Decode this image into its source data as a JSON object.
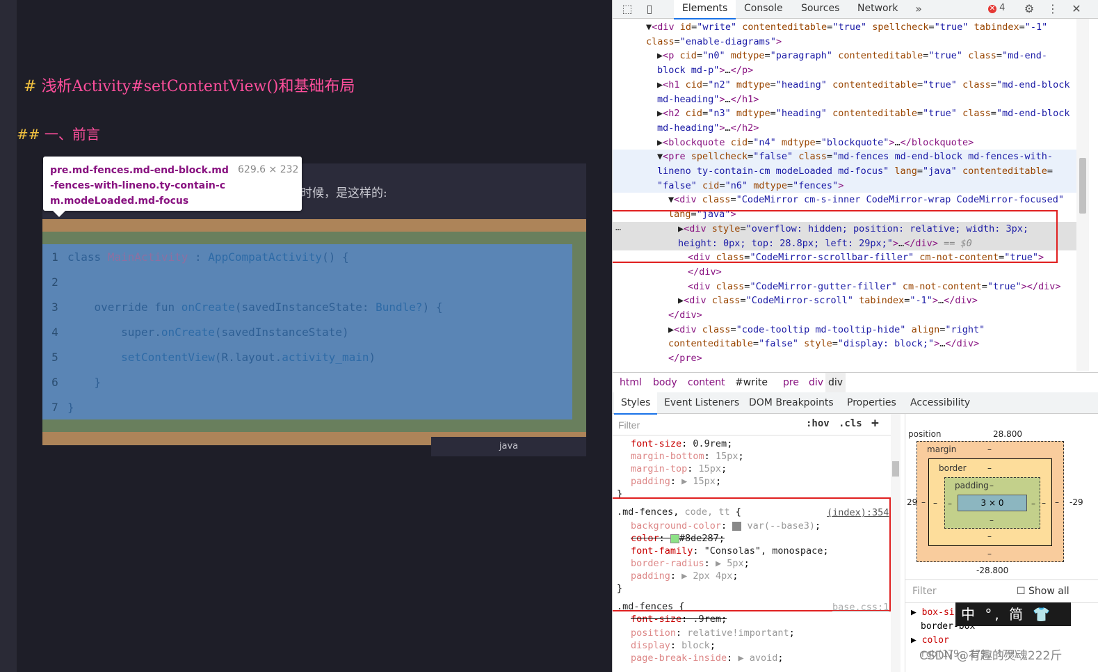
{
  "editor": {
    "h1_hash": "#",
    "h1_text": "浅析Activity#setContentView()和基础布局",
    "h2_hash": "##",
    "h2_text": "一、前言",
    "quote_text": "时候，是这样的:",
    "lang_label": "java",
    "code": [
      {
        "n": "1",
        "parts": [
          [
            "kw",
            "class "
          ],
          [
            "ty",
            "MainActivity"
          ],
          [
            "kw",
            " : "
          ],
          [
            "fn",
            "AppCompatActivity"
          ],
          [
            "kw",
            "() {"
          ]
        ]
      },
      {
        "n": "2",
        "parts": []
      },
      {
        "n": "3",
        "parts": [
          [
            "kw",
            "    override fun "
          ],
          [
            "fn",
            "onCreate"
          ],
          [
            "kw",
            "(savedInstanceState: "
          ],
          [
            "fn",
            "Bundle?"
          ],
          [
            "kw",
            ") {"
          ]
        ]
      },
      {
        "n": "4",
        "parts": [
          [
            "kw",
            "        super."
          ],
          [
            "fn",
            "onCreate"
          ],
          [
            "kw",
            "(savedInstanceState)"
          ]
        ]
      },
      {
        "n": "5",
        "parts": [
          [
            "kw",
            "        "
          ],
          [
            "fn",
            "setContentView"
          ],
          [
            "kw",
            "(R.layout."
          ],
          [
            "fn",
            "activity_main"
          ],
          [
            "kw",
            ")"
          ]
        ]
      },
      {
        "n": "6",
        "parts": [
          [
            "kw",
            "    }"
          ]
        ]
      },
      {
        "n": "7",
        "parts": [
          [
            "kw",
            "}"
          ]
        ]
      }
    ]
  },
  "tooltip": {
    "selector": "pre.md-fences.md-end-block.md-fences-with-lineno.ty-contain-cm.modeLoaded.md-focus",
    "dimensions": "629.6 × 232"
  },
  "toolbar": {
    "tabs": [
      "Elements",
      "Console",
      "Sources",
      "Network"
    ],
    "more": "»",
    "error_count": "4",
    "error_mark": "✕"
  },
  "dom_lines": [
    {
      "html": "▼<span class='t'>&lt;div</span> <span class='a'>id</span>=<span class='v'>\"write\"</span> <span class='a'>contenteditable</span>=<span class='v'>\"true\"</span> <span class='a'>spellcheck</span>=<span class='v'>\"true\"</span> <span class='a'>tabindex</span>=<span class='v'>\"-1\"</span>"
    },
    {
      "html": "<span class='a'>class</span>=<span class='v'>\"enable-diagrams\"</span><span class='t'>&gt;</span>"
    },
    {
      "html": "▶<span class='t'>&lt;p</span> <span class='a'>cid</span>=<span class='v'>\"n0\"</span> <span class='a'>mdtype</span>=<span class='v'>\"paragraph\"</span> <span class='a'>contenteditable</span>=<span class='v'>\"true\"</span> <span class='a'>class</span>=<span class='v'>\"md-end-</span>"
    },
    {
      "html": "<span class='v'>block md-p\"</span><span class='t'>&gt;</span>…<span class='t'>&lt;/p&gt;</span>"
    },
    {
      "html": "▶<span class='t'>&lt;h1</span> <span class='a'>cid</span>=<span class='v'>\"n2\"</span> <span class='a'>mdtype</span>=<span class='v'>\"heading\"</span> <span class='a'>contenteditable</span>=<span class='v'>\"true\"</span> <span class='a'>class</span>=<span class='v'>\"md-end-block</span>"
    },
    {
      "html": "<span class='v'>md-heading\"</span><span class='t'>&gt;</span>…<span class='t'>&lt;/h1&gt;</span>"
    },
    {
      "html": "▶<span class='t'>&lt;h2</span> <span class='a'>cid</span>=<span class='v'>\"n3\"</span> <span class='a'>mdtype</span>=<span class='v'>\"heading\"</span> <span class='a'>contenteditable</span>=<span class='v'>\"true\"</span> <span class='a'>class</span>=<span class='v'>\"md-end-block</span>"
    },
    {
      "html": "<span class='v'>md-heading\"</span><span class='t'>&gt;</span>…<span class='t'>&lt;/h2&gt;</span>"
    },
    {
      "html": "▶<span class='t'>&lt;blockquote</span> <span class='a'>cid</span>=<span class='v'>\"n4\"</span> <span class='a'>mdtype</span>=<span class='v'>\"blockquote\"</span><span class='t'>&gt;</span>…<span class='t'>&lt;/blockquote&gt;</span>"
    },
    {
      "html": "▼<span class='t'>&lt;pre</span> <span class='a'>spellcheck</span>=<span class='v'>\"false\"</span> <span class='a'>class</span>=<span class='v'>\"md-fences md-end-block md-fences-with-</span>"
    },
    {
      "html": "<span class='v'>lineno ty-contain-cm modeLoaded md-focus\"</span> <span class='a'>lang</span>=<span class='v'>\"java\"</span> <span class='a'>contenteditable</span>="
    },
    {
      "html": "<span class='v'>\"false\"</span> <span class='a'>cid</span>=<span class='v'>\"n6\"</span> <span class='a'>mdtype</span>=<span class='v'>\"fences\"</span><span class='t'>&gt;</span>"
    },
    {
      "html": "▼<span class='t'>&lt;div</span> <span class='a'>class</span>=<span class='v'>\"CodeMirror cm-s-inner CodeMirror-wrap CodeMirror-focused\"</span>"
    },
    {
      "html": "<span class='a'>lang</span>=<span class='v'>\"java\"</span><span class='t'>&gt;</span>"
    },
    {
      "html": "▶<span class='t'>&lt;div</span> <span class='a'>style</span>=<span class='v'>\"overflow: hidden; position: relative; width: 3px;</span>"
    },
    {
      "html": "<span class='v'>height: 0px; top: 28.8px; left: 29px;\"</span><span class='t'>&gt;</span>…<span class='t'>&lt;/div&gt;</span> <span class='eq'>== $0</span>"
    },
    {
      "html": "<span class='t'>&lt;div</span> <span class='a'>class</span>=<span class='v'>\"CodeMirror-scrollbar-filler\"</span> <span class='a'>cm-not-content</span>=<span class='v'>\"true\"</span><span class='t'>&gt;</span>"
    },
    {
      "html": "<span class='t'>&lt;/div&gt;</span>"
    },
    {
      "html": "<span class='t'>&lt;div</span> <span class='a'>class</span>=<span class='v'>\"CodeMirror-gutter-filler\"</span> <span class='a'>cm-not-content</span>=<span class='v'>\"true\"</span><span class='t'>&gt;&lt;/div&gt;</span>"
    },
    {
      "html": "▶<span class='t'>&lt;div</span> <span class='a'>class</span>=<span class='v'>\"CodeMirror-scroll\"</span> <span class='a'>tabindex</span>=<span class='v'>\"-1\"</span><span class='t'>&gt;</span>…<span class='t'>&lt;/div&gt;</span>"
    },
    {
      "html": "<span class='t'>&lt;/div&gt;</span>"
    },
    {
      "html": "▶<span class='t'>&lt;div</span> <span class='a'>class</span>=<span class='v'>\"code-tooltip md-tooltip-hide\"</span> <span class='a'>align</span>=<span class='v'>\"right\"</span>"
    },
    {
      "html": "<span class='a'>contenteditable</span>=<span class='v'>\"false\"</span> <span class='a'>style</span>=<span class='v'>\"display: block;\"</span><span class='t'>&gt;</span>…<span class='t'>&lt;/div&gt;</span>"
    },
    {
      "html": "<span class='t'>&lt;/pre&gt;</span>"
    }
  ],
  "dom_ellipsis": "…",
  "breadcrumbs": [
    "html",
    "body",
    "content",
    "#write",
    "pre",
    "div",
    "div"
  ],
  "subtabs": [
    "Styles",
    "Event Listeners",
    "DOM Breakpoints",
    "Properties",
    "Accessibility"
  ],
  "styles": {
    "filter_placeholder": "Filter",
    "hov": ":hov",
    "cls": ".cls",
    "plus": "+",
    "lines": [
      {
        "html": "<span class='pn'>font-size</span>: <span class='pv'>0.9rem</span>;"
      },
      {
        "html": "<span class='pn dim'>margin-bottom</span>: <span class='pv dim'>15px</span>;"
      },
      {
        "html": "<span class='pn dim'>margin-top</span>: <span class='pv dim'>15px</span>;"
      },
      {
        "html": "<span class='pn dim'>padding</span>: <span class='pv dim'>▶ 15px</span>;"
      },
      {
        "html": "}"
      },
      {
        "html": "<span class='selector'>.md-fences</span>, <span class='pv dim'>code, tt</span> {"
      },
      {
        "html": "<span class='pn dim'>background-color</span>: <span class='swatch' style='background:#888'></span> <span class='pv dim'>var(--base3)</span>;"
      },
      {
        "html": "<span class='strike'><span class='pn'>color</span>: <span class='swatch' style='background:#8de287'></span><span class='pv'>#8de287</span>;</span>"
      },
      {
        "html": "<span class='pn'>font-family</span>: <span class='pv'>\"Consolas\", monospace</span>;"
      },
      {
        "html": "<span class='pn dim'>border-radius</span>: <span class='pv dim'>▶ 5px</span>;"
      },
      {
        "html": "<span class='pn dim'>padding</span>: <span class='pv dim'>▶ 2px 4px</span>;"
      },
      {
        "html": "}"
      },
      {
        "html": "<span class='selector'>.md-fences</span> {"
      },
      {
        "html": "<span class='strike'><span class='pn'>font-size</span>: <span class='pv'>.9rem</span>;</span>"
      },
      {
        "html": "<span class='pn dim'>position</span>: <span class='pv dim'>relative!important</span>;"
      },
      {
        "html": "<span class='pn dim'>display</span>: <span class='pv dim'>block</span>;"
      },
      {
        "html": "<span class='pn dim'>page-break-inside</span>: <span class='pv dim'>▶ avoid</span>;"
      }
    ],
    "link1": "(index):354",
    "link2": "base.css:1"
  },
  "boxmodel": {
    "position_label": "position",
    "position_top": "28.800",
    "position_bottom": "-28.800",
    "position_left": "29",
    "position_right": "-29",
    "margin_label": "margin",
    "border_label": "border",
    "padding_label": "padding",
    "dash": "–",
    "content": "3 × 0",
    "filter_placeholder": "Filter",
    "show_all": "Show all",
    "computed": [
      {
        "name": "box-sizing",
        "value": "border-box"
      },
      {
        "name": "color",
        "value": "rgb(179, 179, 179)"
      }
    ]
  },
  "ime": "中 °, 简 👕 ⚙",
  "watermark": "CSDN @有趣的灵魂222斤"
}
